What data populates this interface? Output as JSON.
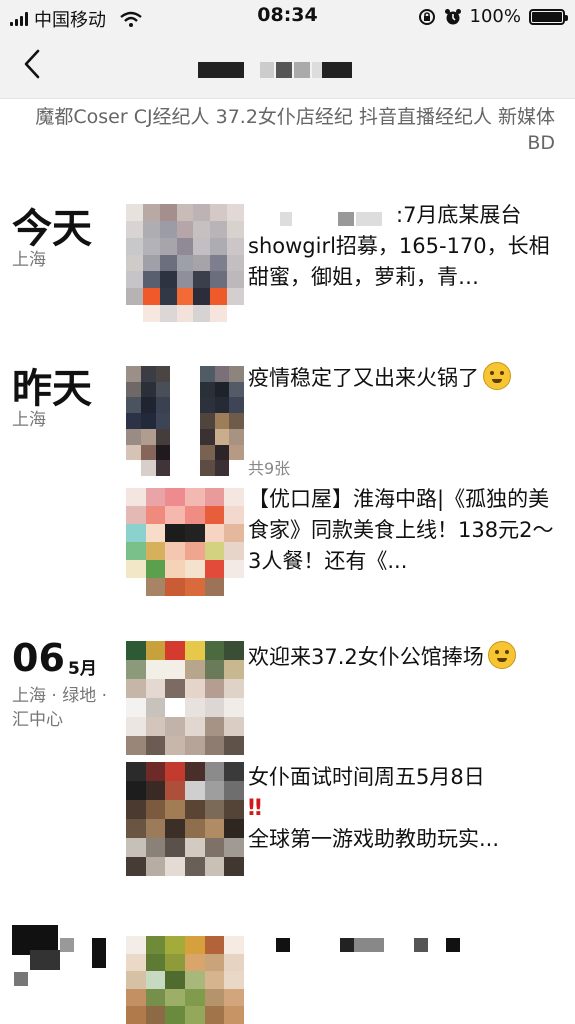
{
  "status_bar": {
    "carrier": "中国移动",
    "time": "08:34",
    "battery": "100%",
    "battery_level": 1.0
  },
  "header": {
    "bio": "魔都Coser CJ经纪人 37.2女仆店经纪 抖音直播经纪人 新媒体BD"
  },
  "posts": [
    {
      "day": "今天",
      "location": "上海",
      "text": ":7月底某展台showgirl招募，165-170，长相甜蜜，御姐，萝莉，青…"
    },
    {
      "day": "昨天",
      "location": "上海",
      "entries": [
        {
          "text": "疫情稳定了又出来火锅了",
          "count": "共9张",
          "emoji": "flushed-face"
        },
        {
          "text": "【优口屋】淮海中路|《孤独的美食家》同款美食上线！138元2～3人餐！还有《..."
        }
      ]
    },
    {
      "day_num": "06",
      "month": "5月",
      "location": "上海 · 绿地 ·汇中心",
      "entries": [
        {
          "text": "欢迎来37.2女仆公馆捧场",
          "emoji": "thinking-face"
        },
        {
          "text_line1": "女仆面试时间周五5月8日",
          "bang": "‼",
          "text_line2": "全球第一游戏助教助玩实..."
        }
      ]
    }
  ],
  "colors": {
    "background": "#ffffff",
    "nav_background": "#f2f2f2",
    "secondary_text": "#777777"
  }
}
